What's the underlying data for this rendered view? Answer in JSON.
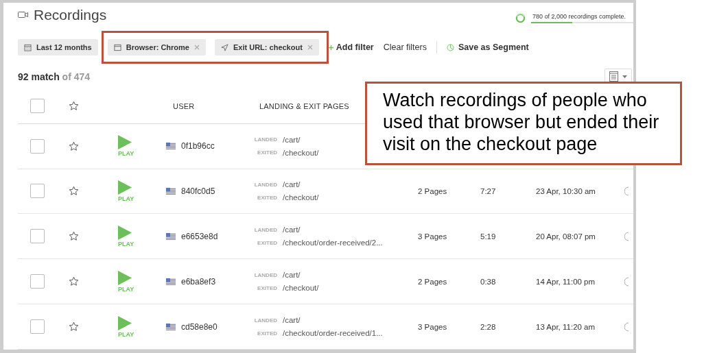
{
  "page": {
    "title": "Recordings"
  },
  "progress": {
    "text": "780 of 2,000 recordings complete.",
    "level": 0.4
  },
  "filters": [
    {
      "kind": "date",
      "label": "Last 12 months",
      "removable": false,
      "highlighted": false
    },
    {
      "kind": "browser",
      "label": "Browser: Chrome",
      "removable": true,
      "highlighted": true
    },
    {
      "kind": "url",
      "label": "Exit URL: checkout",
      "removable": true,
      "highlighted": true
    }
  ],
  "actions": {
    "add_filter": "Add filter",
    "clear_filters": "Clear filters",
    "save_segment": "Save as Segment"
  },
  "summary": {
    "matched": "92 match",
    "total": "of 474"
  },
  "table": {
    "header_checked": false,
    "header_starred": false,
    "columns": [
      {
        "kind": "user",
        "label": "USER"
      },
      {
        "kind": "pages",
        "label": "LANDING & EXIT PAGES"
      }
    ],
    "rows": [
      {
        "checked": false,
        "starred": false,
        "play": "PLAY",
        "user": "0f1b96cc",
        "landed_label": "LANDED",
        "landed": "/cart/",
        "exited_label": "EXITED",
        "exited": "/checkout/"
      },
      {
        "checked": false,
        "starred": false,
        "play": "PLAY",
        "user": "840fc0d5",
        "landed_label": "LANDED",
        "landed": "/cart/",
        "exited_label": "EXITED",
        "exited": "/checkout/",
        "pages": "2 Pages",
        "duration": "7:27",
        "date": "23 Apr, 10:30 am"
      },
      {
        "checked": false,
        "starred": false,
        "play": "PLAY",
        "user": "e6653e8d",
        "landed_label": "LANDED",
        "landed": "/cart/",
        "exited_label": "EXITED",
        "exited": "/checkout/order-received/2...",
        "pages": "3 Pages",
        "duration": "5:19",
        "date": "20 Apr, 08:07 pm"
      },
      {
        "checked": false,
        "starred": false,
        "play": "PLAY",
        "user": "e6ba8ef3",
        "landed_label": "LANDED",
        "landed": "/cart/",
        "exited_label": "EXITED",
        "exited": "/checkout/",
        "pages": "2 Pages",
        "duration": "0:38",
        "date": "14 Apr, 11:00 pm"
      },
      {
        "checked": false,
        "starred": false,
        "play": "PLAY",
        "user": "cd58e8e0",
        "landed_label": "LANDED",
        "landed": "/cart/",
        "exited_label": "EXITED",
        "exited": "/checkout/order-received/1...",
        "pages": "3 Pages",
        "duration": "2:28",
        "date": "13 Apr, 11:20 am"
      }
    ]
  },
  "callout": {
    "text": "Watch recordings of people who used that browser but ended their visit on the checkout page"
  }
}
